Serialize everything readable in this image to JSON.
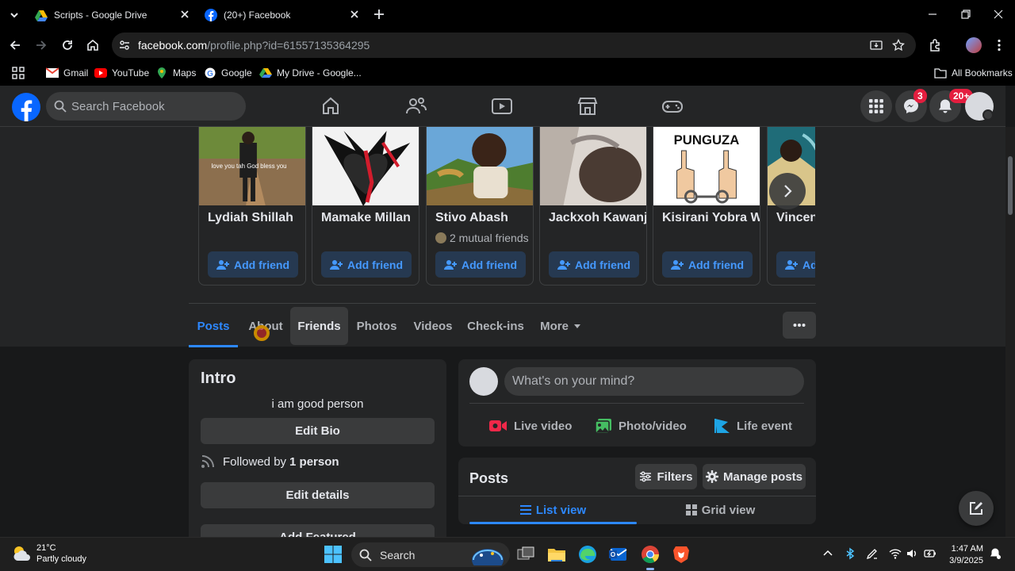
{
  "browser": {
    "tabs": [
      {
        "title": "Scripts - Google Drive",
        "active": false
      },
      {
        "title": "(20+) Facebook",
        "active": true
      }
    ],
    "url_host": "facebook.com",
    "url_path": "/profile.php?id=61557135364295",
    "bookmarks": [
      "Gmail",
      "YouTube",
      "Maps",
      "Google",
      "My Drive - Google..."
    ],
    "all_bookmarks": "All Bookmarks"
  },
  "fb": {
    "search_placeholder": "Search Facebook",
    "messenger_badge": "3",
    "notif_badge": "20+"
  },
  "people": [
    {
      "name": "Lydiah Shillah",
      "mutual": "",
      "button": "Add friend"
    },
    {
      "name": "Mamake Millan",
      "mutual": "",
      "button": "Add friend"
    },
    {
      "name": "Stivo Abash",
      "mutual": "2 mutual friends",
      "button": "Add friend"
    },
    {
      "name": "Jackxoh Kawanji",
      "mutual": "",
      "button": "Add friend"
    },
    {
      "name": "Kisirani Yobra W",
      "mutual": "",
      "button": "Add friend"
    },
    {
      "name": "Vincent",
      "mutual": "",
      "button": "Add friend"
    }
  ],
  "people_photo_captions": {
    "lydiah": "love you tah God bless you",
    "kisirani": "PUNGUZA"
  },
  "profile_tabs": [
    "Posts",
    "About",
    "Friends",
    "Photos",
    "Videos",
    "Check-ins",
    "More"
  ],
  "intro": {
    "title": "Intro",
    "bio": "i am good person",
    "edit_bio": "Edit Bio",
    "followed_prefix": "Followed by",
    "followed_count": "1 person",
    "edit_details": "Edit details",
    "add_featured": "Add Featured"
  },
  "composer": {
    "placeholder": "What's on your mind?",
    "live": "Live video",
    "photo": "Photo/video",
    "life": "Life event"
  },
  "posts": {
    "title": "Posts",
    "filters": "Filters",
    "manage": "Manage posts",
    "list_view": "List view",
    "grid_view": "Grid view"
  },
  "taskbar": {
    "temp": "21°C",
    "condition": "Partly cloudy",
    "search": "Search",
    "time": "1:47 AM",
    "date": "3/9/2025"
  },
  "colors": {
    "fb_blue": "#0866ff",
    "accent_blue": "#2d88ff",
    "badge_red": "#e41e3f"
  }
}
